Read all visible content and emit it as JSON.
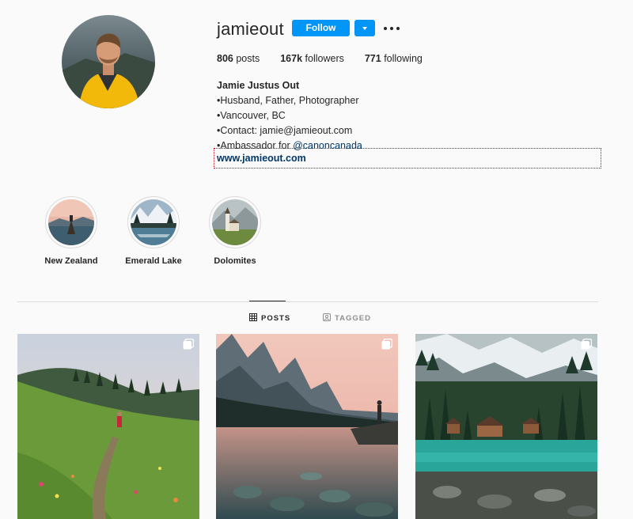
{
  "profile": {
    "username": "jamieout",
    "follow_label": "Follow"
  },
  "stats": [
    {
      "value": "806",
      "label": "posts"
    },
    {
      "value": "167k",
      "label": "followers"
    },
    {
      "value": "771",
      "label": "following"
    }
  ],
  "bio": {
    "name": "Jamie Justus Out",
    "lines": [
      "•Husband, Father, Photographer",
      "•Vancouver, BC",
      "•Contact: jamie@jamieout.com"
    ],
    "ambassador_prefix": "•Ambassador for ",
    "ambassador_mention": "@canoncanada",
    "website": "www.jamieout.com"
  },
  "highlights": [
    {
      "label": "New Zealand"
    },
    {
      "label": "Emerald Lake"
    },
    {
      "label": "Dolomites"
    }
  ],
  "tabs": {
    "posts": "POSTS",
    "tagged": "TAGGED"
  },
  "icons": {
    "more": "more-options-icon",
    "dropdown": "chevron-down-icon",
    "posts_tab": "grid-icon",
    "tagged_tab": "tag-person-icon",
    "multi_post": "carousel-icon"
  },
  "colors": {
    "accent": "#0095f6",
    "link": "#00376b",
    "text": "#262626",
    "muted": "#8e8e8e",
    "divider": "#dbdbdb"
  }
}
